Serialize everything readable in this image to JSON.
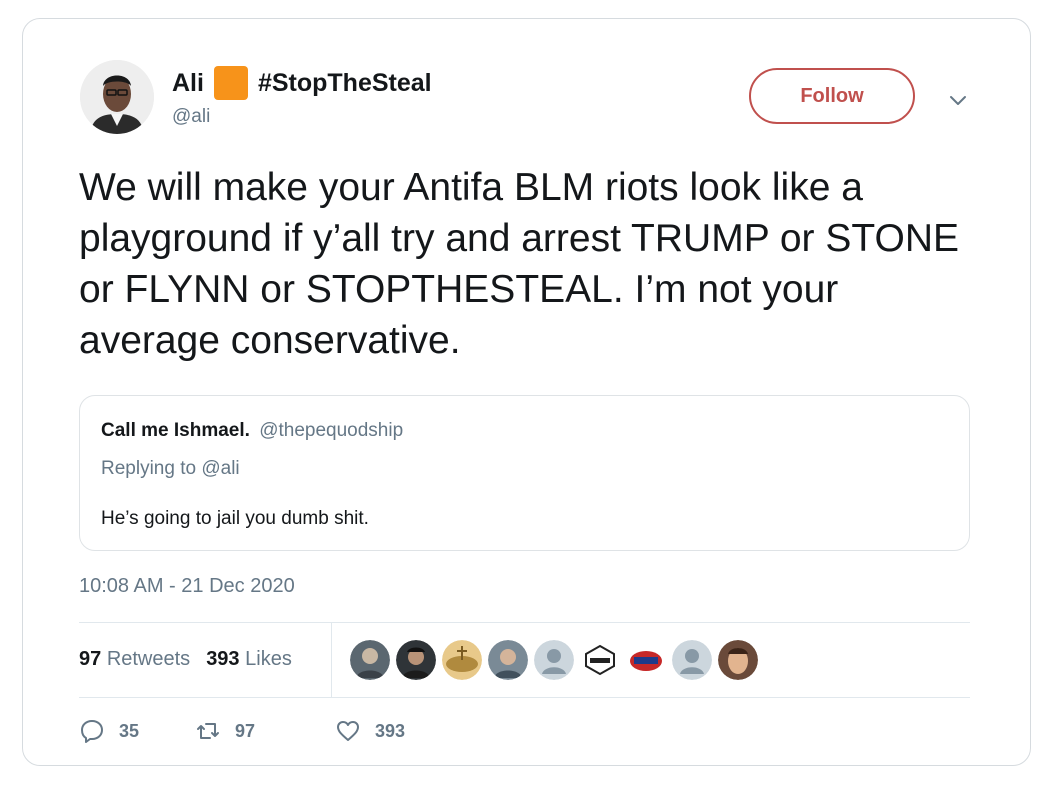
{
  "tweet": {
    "display_name": "Ali",
    "hashtag_name": "#StopTheSteal",
    "handle": "@ali",
    "follow_label": "Follow",
    "text": "We will make your Antifa BLM riots look like a playground if y’all try and arrest TRUMP or STONE or FLYNN or STOPTHESTEAL. I’m not your average conservative.",
    "timestamp": "10:08 AM - 21 Dec 2020"
  },
  "quote": {
    "name": "Call me Ishmael.",
    "handle": "@thepequodship",
    "replying_prefix": "Replying to",
    "replying_handle": "@ali",
    "text": "He’s going to jail you dumb shit."
  },
  "stats": {
    "retweets_count": "97",
    "retweets_label": "Retweets",
    "likes_count": "393",
    "likes_label": "Likes"
  },
  "likers": [
    {
      "icon": "liker-avatar-1"
    },
    {
      "icon": "liker-avatar-2"
    },
    {
      "icon": "liker-avatar-3"
    },
    {
      "icon": "liker-avatar-4"
    },
    {
      "icon": "liker-avatar-default"
    },
    {
      "icon": "liker-avatar-maverick"
    },
    {
      "icon": "liker-avatar-maga"
    },
    {
      "icon": "liker-avatar-default"
    },
    {
      "icon": "liker-avatar-9"
    }
  ],
  "actions": {
    "replies": "35",
    "retweets": "97",
    "likes": "393"
  },
  "colors": {
    "follow_accent": "#c0504d",
    "muted_text": "#657786",
    "orange_square": "#f7931a"
  }
}
